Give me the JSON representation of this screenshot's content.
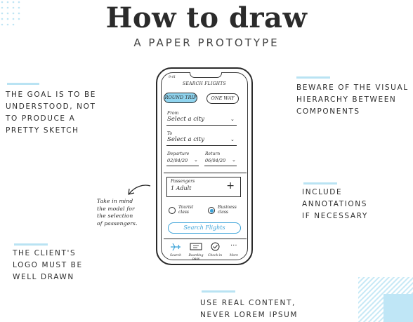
{
  "title": "How to draw",
  "subtitle": "A PAPER PROTOTYPE",
  "notes": {
    "goal": "THE GOAL IS TO BE\nUNDERSTOOD, NOT\nTO PRODUCE A\nPRETTY SKETCH",
    "hierarchy": "BEWARE OF THE VISUAL\nHIERARCHY BETWEEN\nCOMPONENTS",
    "annotations": "INCLUDE\nANNOTATIONS\nIF NECESSARY",
    "logo": "THE CLIENT'S\nLOGO MUST BE\nWELL DRAWN",
    "content": "USE REAL CONTENT,\nNEVER LOREM IPSUM"
  },
  "annotation": "Take in mind\nthe modal for\nthe selection\nof passengers.",
  "accent_color": "#b9e3f3",
  "sketch": {
    "time": "9:41",
    "header": "SEARCH FLIGHTS",
    "round_trip": "ROUND TRIP",
    "one_way": "ONE WAY",
    "from_label": "From",
    "from_value": "Select a city",
    "to_label": "To",
    "to_value": "Select a city",
    "departure_label": "Departure",
    "departure_value": "02/04/20",
    "return_label": "Return",
    "return_value": "06/04/20",
    "passengers_label": "Passengers",
    "passengers_value": "1 Adult",
    "plus": "+",
    "tourist_class": "Tourist\nclass",
    "business_class": "Business\nclass",
    "search_button": "Search Flights",
    "tabs": [
      "Search",
      "Boarding pass",
      "Check-in",
      "More"
    ],
    "more_glyph": "..."
  }
}
